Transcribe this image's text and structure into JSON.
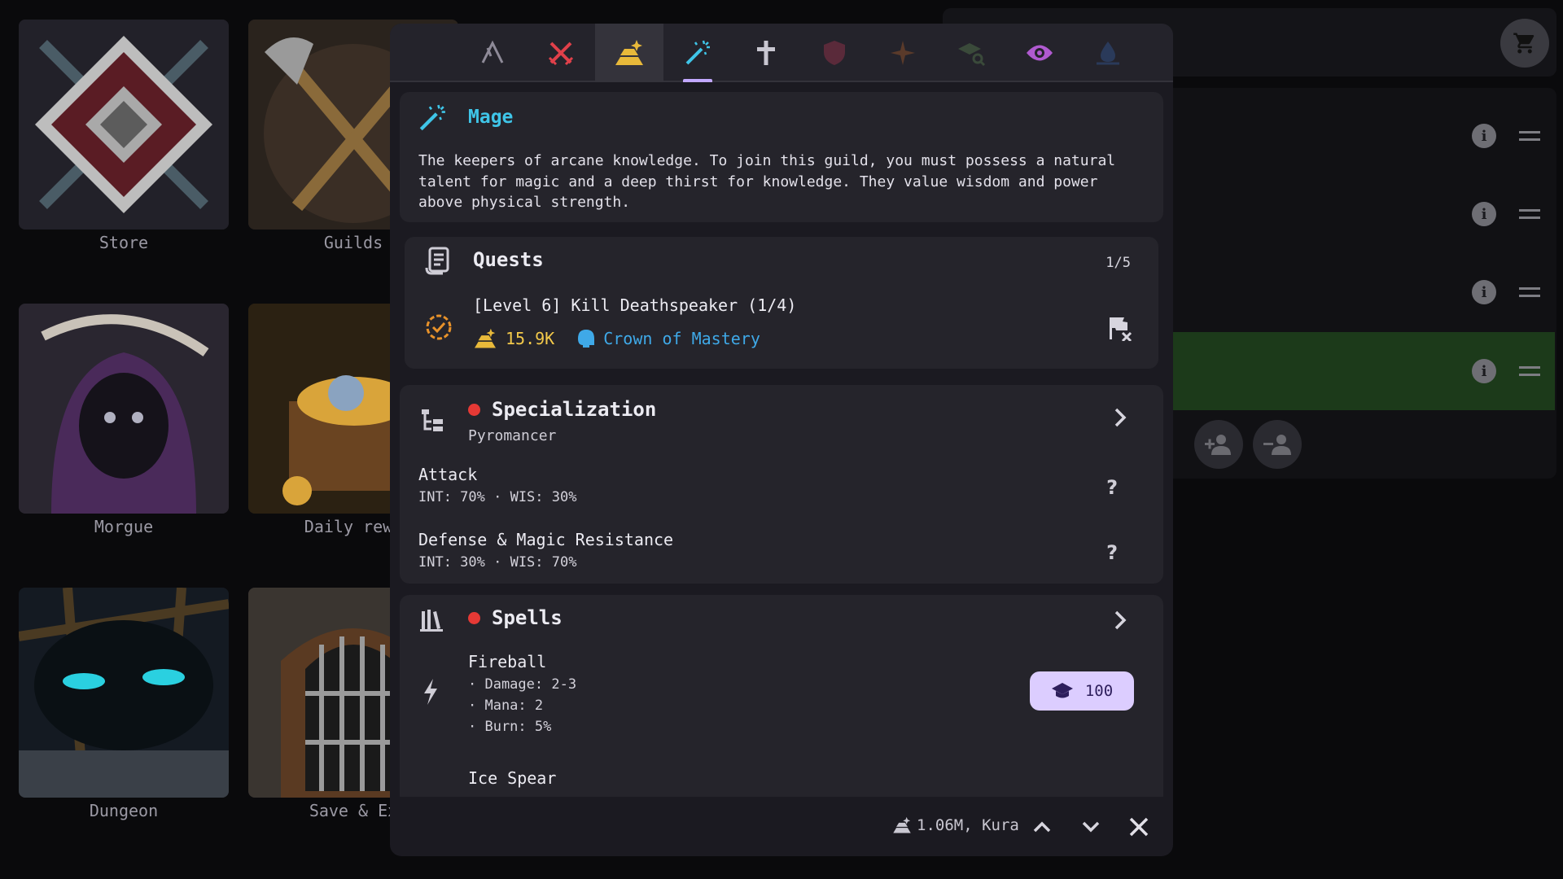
{
  "background": {
    "tiles": [
      {
        "label": "Store"
      },
      {
        "label": "Guilds"
      },
      {
        "label": "Morgue"
      },
      {
        "label": "Daily rewa"
      },
      {
        "label": "Dungeon"
      },
      {
        "label": "Save & Ex"
      }
    ]
  },
  "tabs": [
    {
      "icon": "warrior-icon",
      "color": "#8e8a98"
    },
    {
      "icon": "crossed-swords-icon",
      "color": "#e0404a"
    },
    {
      "icon": "gold-pile-icon",
      "color": "#e8b93a"
    },
    {
      "icon": "magic-wand-icon",
      "color": "#3fc5e8"
    },
    {
      "icon": "cross-icon",
      "color": "#c8c6d0"
    },
    {
      "icon": "shield-icon",
      "color": "#5a2a3a"
    },
    {
      "icon": "star-icon",
      "color": "#5a3a2a"
    },
    {
      "icon": "graduation-cap-search-icon",
      "color": "#3a4a3a"
    },
    {
      "icon": "eye-icon",
      "color": "#b05ad0"
    },
    {
      "icon": "water-drop-icon",
      "color": "#2a3a5a"
    }
  ],
  "guild": {
    "name": "Mage",
    "description": "The keepers of arcane knowledge. To join this guild, you must possess a natural talent for magic and a deep thirst for knowledge. They value wisdom and power above physical strength."
  },
  "quests": {
    "title": "Quests",
    "count": "1/5",
    "current": {
      "name": "[Level 6] Kill Deathspeaker (1/4)",
      "gold": "15.9K",
      "item": "Crown of Mastery"
    }
  },
  "specialization": {
    "title": "Specialization",
    "subtitle": "Pyromancer",
    "attack_label": "Attack",
    "attack_stats": "INT: 70% · WIS: 30%",
    "defense_label": "Defense & Magic Resistance",
    "defense_stats": "INT: 30% · WIS: 70%",
    "help": "?"
  },
  "spells": {
    "title": "Spells",
    "items": [
      {
        "name": "Fireball",
        "lines": [
          "· Damage: 2-3",
          "· Mana: 2",
          "· Burn: 5%"
        ],
        "cost": "100"
      },
      {
        "name": "Ice Spear"
      }
    ]
  },
  "footer": {
    "status": "1.06M, Kura"
  }
}
